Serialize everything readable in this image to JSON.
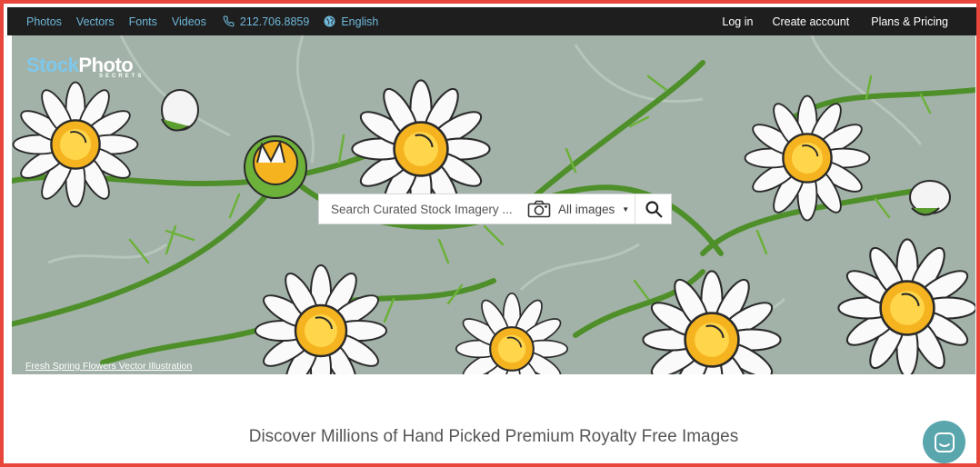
{
  "nav": {
    "links": [
      "Photos",
      "Vectors",
      "Fonts",
      "Videos"
    ],
    "phone": "212.706.8859",
    "language": "English",
    "login": "Log in",
    "create_account": "Create account",
    "pricing": "Plans & Pricing"
  },
  "hero": {
    "logo_main_1": "Stock",
    "logo_main_2": "Photo",
    "logo_sub": "SECRETS",
    "caption": "Fresh Spring Flowers Vector Illustration"
  },
  "search": {
    "placeholder": "Search Curated Stock Imagery ...",
    "filter": "All images",
    "camera_icon": "camera-icon",
    "submit_icon": "search-icon"
  },
  "main": {
    "tagline": "Discover Millions of Hand Picked Premium Royalty Free Images"
  },
  "chat": {
    "icon": "chat-icon"
  },
  "colors": {
    "frame": "#e8463a",
    "nav_bg": "#1e1e1e",
    "nav_link": "#6fb7d8",
    "hero_bg": "#a2b2a8",
    "chat_bg": "#5aa6ad"
  }
}
